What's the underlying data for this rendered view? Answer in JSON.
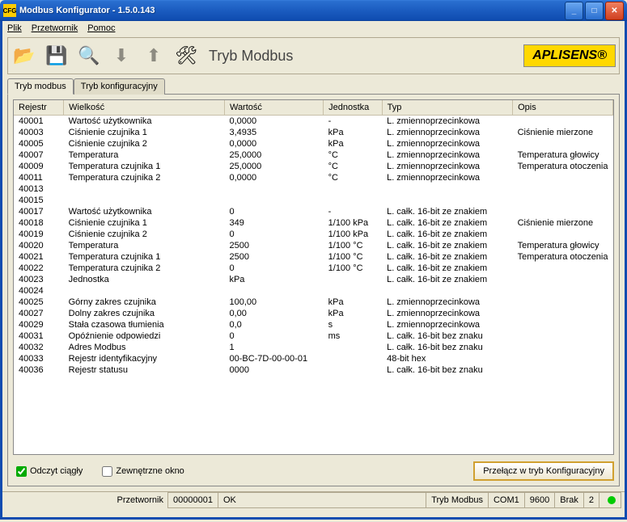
{
  "window": {
    "title": "Modbus Konfigurator  -  1.5.0.143"
  },
  "menu": {
    "file": "Plik",
    "converter": "Przetwornik",
    "help": "Pomoc"
  },
  "toolbar": {
    "mode_label": "Tryb Modbus",
    "logo": "APLISENS®"
  },
  "tabs": {
    "modbus": "Tryb modbus",
    "config": "Tryb konfiguracyjny"
  },
  "columns": {
    "register": "Rejestr",
    "quantity": "Wielkość",
    "value": "Wartość",
    "unit": "Jednostka",
    "type": "Typ",
    "desc": "Opis"
  },
  "rows": [
    {
      "r": "40001",
      "q": "Wartość użytkownika",
      "v": "0,0000",
      "u": "-",
      "t": "L. zmiennoprzecinkowa",
      "d": ""
    },
    {
      "r": "40003",
      "q": "Ciśnienie czujnika 1",
      "v": "3,4935",
      "u": "kPa",
      "t": "L. zmiennoprzecinkowa",
      "d": "Ciśnienie mierzone"
    },
    {
      "r": "40005",
      "q": "Ciśnienie czujnika 2",
      "v": "0,0000",
      "u": "kPa",
      "t": "L. zmiennoprzecinkowa",
      "d": ""
    },
    {
      "r": "40007",
      "q": "Temperatura",
      "v": "25,0000",
      "u": "°C",
      "t": "L. zmiennoprzecinkowa",
      "d": "Temperatura głowicy"
    },
    {
      "r": "40009",
      "q": "Temperatura czujnika 1",
      "v": "25,0000",
      "u": "°C",
      "t": "L. zmiennoprzecinkowa",
      "d": "Temperatura otoczenia"
    },
    {
      "r": "40011",
      "q": "Temperatura czujnika 2",
      "v": "0,0000",
      "u": "°C",
      "t": "L. zmiennoprzecinkowa",
      "d": ""
    },
    {
      "r": "40013",
      "q": "",
      "v": "",
      "u": "",
      "t": "",
      "d": ""
    },
    {
      "r": "40015",
      "q": "",
      "v": "",
      "u": "",
      "t": "",
      "d": ""
    },
    {
      "r": "40017",
      "q": "Wartość użytkownika",
      "v": "0",
      "u": "-",
      "t": "L. całk. 16-bit ze znakiem",
      "d": ""
    },
    {
      "r": "40018",
      "q": "Ciśnienie czujnika 1",
      "v": "349",
      "u": "1/100 kPa",
      "t": "L. całk. 16-bit ze znakiem",
      "d": "Ciśnienie mierzone"
    },
    {
      "r": "40019",
      "q": "Ciśnienie czujnika 2",
      "v": "0",
      "u": "1/100 kPa",
      "t": "L. całk. 16-bit ze znakiem",
      "d": ""
    },
    {
      "r": "40020",
      "q": "Temperatura",
      "v": "2500",
      "u": "1/100 °C",
      "t": "L. całk. 16-bit ze znakiem",
      "d": "Temperatura głowicy"
    },
    {
      "r": "40021",
      "q": "Temperatura czujnika 1",
      "v": "2500",
      "u": "1/100 °C",
      "t": "L. całk. 16-bit ze znakiem",
      "d": "Temperatura otoczenia"
    },
    {
      "r": "40022",
      "q": "Temperatura czujnika 2",
      "v": "0",
      "u": "1/100 °C",
      "t": "L. całk. 16-bit ze znakiem",
      "d": ""
    },
    {
      "r": "40023",
      "q": "Jednostka",
      "v": "kPa",
      "u": "",
      "t": "L. całk. 16-bit ze znakiem",
      "d": ""
    },
    {
      "r": "40024",
      "q": "",
      "v": "",
      "u": "",
      "t": "",
      "d": ""
    },
    {
      "r": "40025",
      "q": "Górny zakres czujnika",
      "v": "100,00",
      "u": "kPa",
      "t": "L. zmiennoprzecinkowa",
      "d": ""
    },
    {
      "r": "40027",
      "q": "Dolny zakres czujnika",
      "v": "0,00",
      "u": "kPa",
      "t": "L. zmiennoprzecinkowa",
      "d": ""
    },
    {
      "r": "40029",
      "q": "Stała czasowa tłumienia",
      "v": "0,0",
      "u": "s",
      "t": "L. zmiennoprzecinkowa",
      "d": ""
    },
    {
      "r": "40031",
      "q": "Opóźnienie odpowiedzi",
      "v": "0",
      "u": "ms",
      "t": "L. całk. 16-bit bez znaku",
      "d": ""
    },
    {
      "r": "40032",
      "q": "Adres Modbus",
      "v": "1",
      "u": "",
      "t": "L. całk. 16-bit bez znaku",
      "d": ""
    },
    {
      "r": "40033",
      "q": "Rejestr identyfikacyjny",
      "v": "00-BC-7D-00-00-01",
      "u": "",
      "t": "48-bit hex",
      "d": ""
    },
    {
      "r": "40036",
      "q": "Rejestr statusu",
      "v": "0000",
      "u": "",
      "t": "L. całk. 16-bit bez znaku",
      "d": ""
    }
  ],
  "checkboxes": {
    "continuous_read": "Odczyt ciągły",
    "external_window": "Zewnętrzne okno"
  },
  "switch_button": "Przełącz w tryb Konfiguracyjny",
  "status": {
    "converter_label": "Przetwornik",
    "converter_id": "00000001",
    "ok": "OK",
    "mode": "Tryb Modbus",
    "port": "COM1",
    "baud": "9600",
    "parity": "Brak",
    "stopbits": "2"
  }
}
